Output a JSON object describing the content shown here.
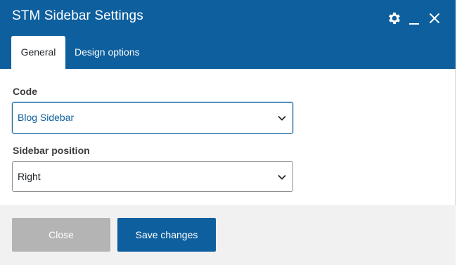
{
  "dialog": {
    "title": "STM Sidebar Settings",
    "header_color": "#0e5f9e",
    "header_icons": [
      "gear-icon",
      "minimize-icon",
      "close-icon"
    ]
  },
  "tabs": [
    {
      "label": "General",
      "active": true
    },
    {
      "label": "Design options",
      "active": false
    }
  ],
  "fields": {
    "code": {
      "label": "Code",
      "value": "Blog Sidebar"
    },
    "sidebar_position": {
      "label": "Sidebar position",
      "value": "Right"
    }
  },
  "footer": {
    "close_label": "Close",
    "save_label": "Save changes"
  }
}
